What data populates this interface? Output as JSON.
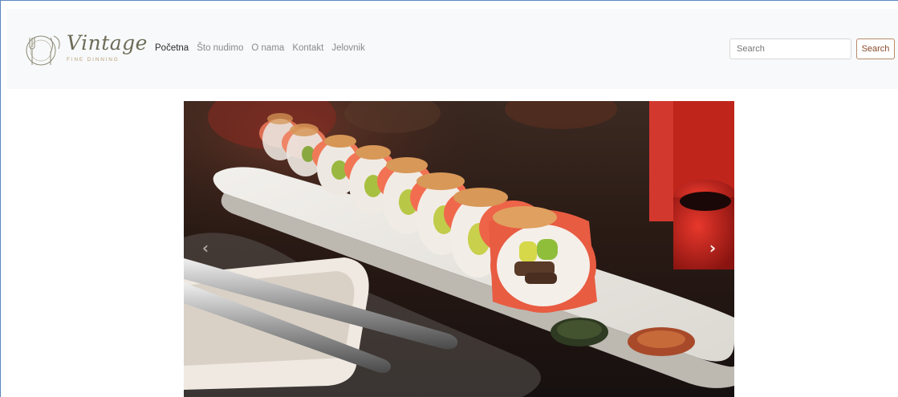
{
  "brand": {
    "name": "Vintage",
    "tagline": "FINE DINNING",
    "icon": "plate-fork-knife-icon"
  },
  "nav": {
    "items": [
      {
        "label": "Početna",
        "active": true
      },
      {
        "label": "Što nudimo",
        "active": false
      },
      {
        "label": "O nama",
        "active": false
      },
      {
        "label": "Kontakt",
        "active": false
      },
      {
        "label": "Jelovnik",
        "active": false
      }
    ]
  },
  "search": {
    "placeholder": "Search",
    "value": "",
    "button_label": "Search"
  },
  "carousel": {
    "image": "sushi-rolls-photo",
    "prev_icon": "chevron-left-icon",
    "next_icon": "chevron-right-icon",
    "prev_glyph": "‹",
    "next_glyph": "›"
  },
  "colors": {
    "navbar_bg": "#f8f9fa",
    "brand_text": "#6d6c58",
    "search_button_border": "#b88a6a",
    "search_button_text": "#8a4a2a"
  }
}
